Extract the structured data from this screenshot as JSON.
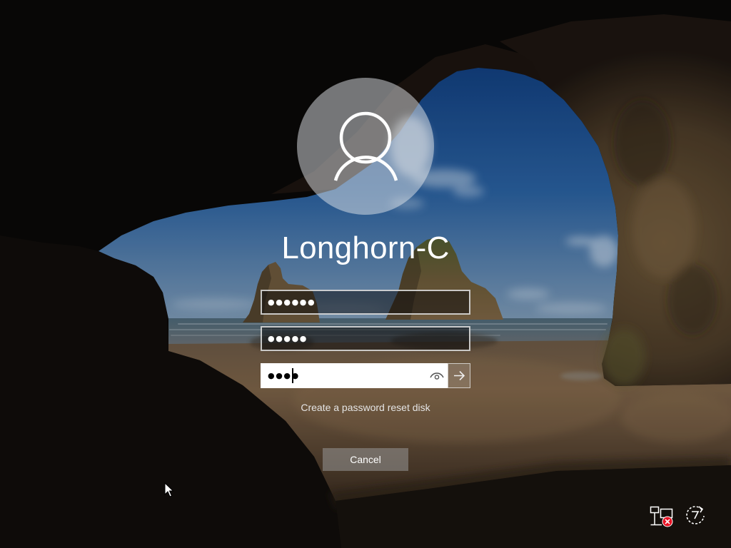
{
  "user": {
    "name": "Longhorn-C",
    "avatar_icon": "user-icon"
  },
  "password_change": {
    "fields": [
      {
        "value": "●●●●●●"
      },
      {
        "value": "●●●●●"
      },
      {
        "value": "●●●●"
      }
    ],
    "reveal_icon": "eye-icon",
    "submit_icon": "arrow-right-icon",
    "reset_disk_link": "Create a password reset disk",
    "cancel_label": "Cancel"
  },
  "corner_controls": {
    "network_icon": "network-disconnected-icon",
    "ease_of_access_icon": "ease-of-access-icon"
  },
  "pointer": {
    "icon": "mouse-pointer-icon"
  },
  "colors": {
    "text": "#ffffff",
    "error_badge": "#e81123",
    "active_field_background": "#ffffff"
  }
}
